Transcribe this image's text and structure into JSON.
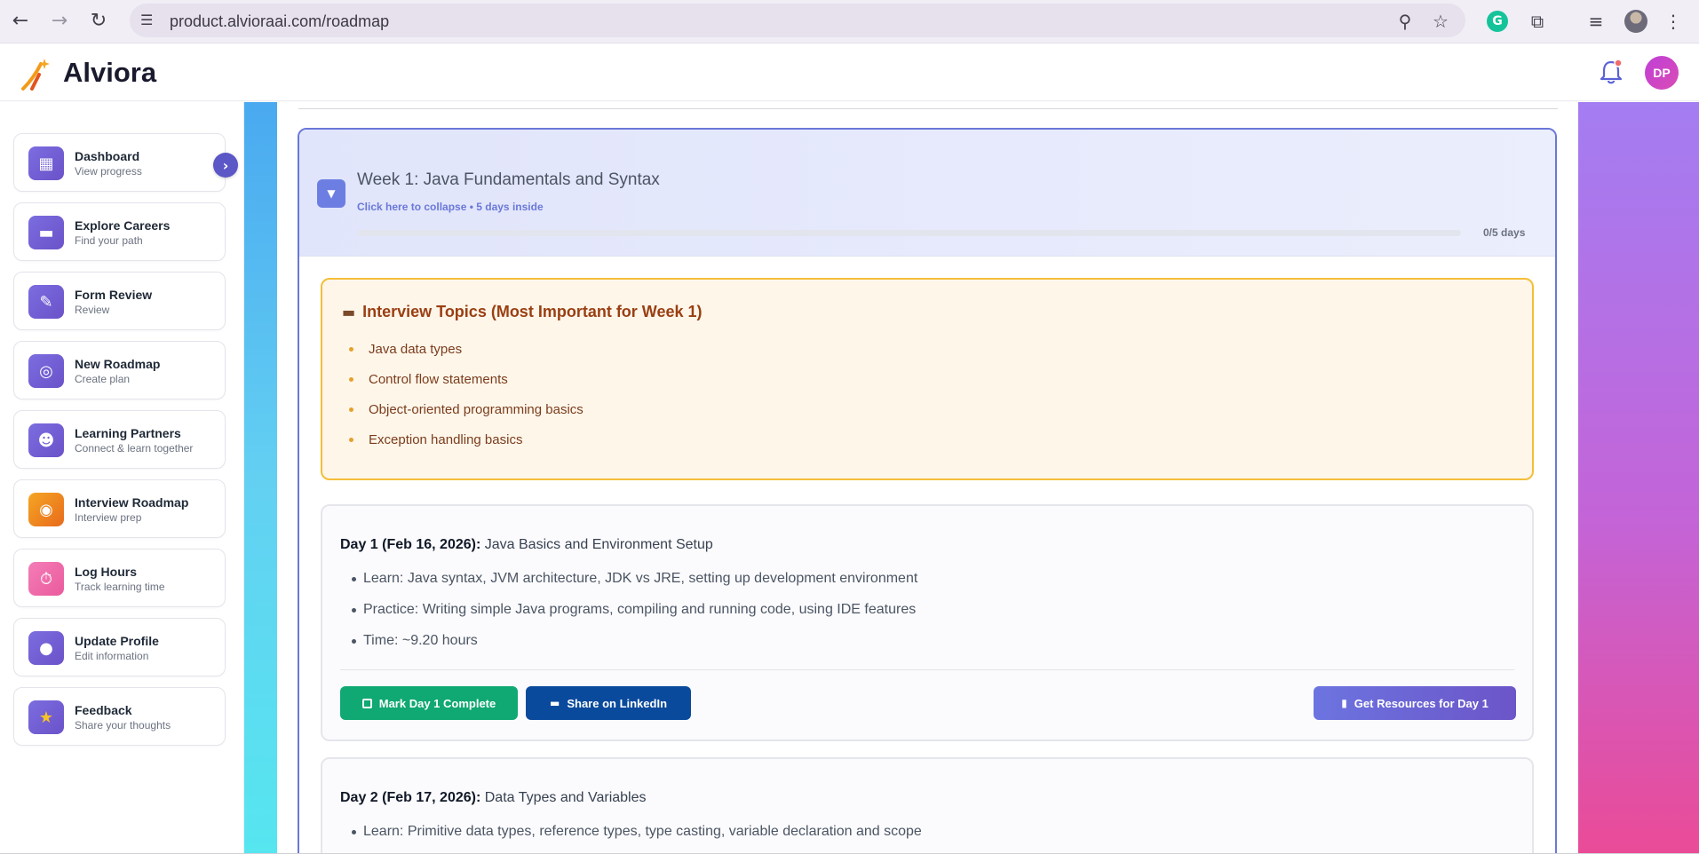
{
  "browser": {
    "url": "product.alvioraai.com/roadmap"
  },
  "app": {
    "name": "Alviora",
    "avatar_initials": "DP",
    "brand_color": "#6a78d8"
  },
  "sidebar": {
    "items": [
      {
        "title": "Dashboard",
        "subtitle": "View progress",
        "icon": "chart-icon"
      },
      {
        "title": "Explore Careers",
        "subtitle": "Find your path",
        "icon": "briefcase-icon"
      },
      {
        "title": "Form Review",
        "subtitle": "Review",
        "icon": "document-icon"
      },
      {
        "title": "New Roadmap",
        "subtitle": "Create plan",
        "icon": "compass-icon"
      },
      {
        "title": "Learning Partners",
        "subtitle": "Connect & learn together",
        "icon": "people-icon"
      },
      {
        "title": "Interview Roadmap",
        "subtitle": "Interview prep",
        "icon": "target-icon"
      },
      {
        "title": "Log Hours",
        "subtitle": "Track learning time",
        "icon": "stopwatch-icon"
      },
      {
        "title": "Update Profile",
        "subtitle": "Edit information",
        "icon": "user-icon"
      },
      {
        "title": "Feedback",
        "subtitle": "Share your thoughts",
        "icon": "star-icon"
      }
    ]
  },
  "week": {
    "title": "Week 1: Java Fundamentals and Syntax",
    "subtitle": "Click here to collapse • 5 days inside",
    "progress_label": "0/5 days",
    "progress_fraction": 0
  },
  "topics": {
    "title": "Interview Topics (Most Important for Week 1)",
    "items": [
      "Java data types",
      "Control flow statements",
      "Object-oriented programming basics",
      "Exception handling basics"
    ]
  },
  "days": [
    {
      "label": "Day 1 (Feb 16, 2026):",
      "topic": "Java Basics and Environment Setup",
      "items": [
        "Learn: Java syntax, JVM architecture, JDK vs JRE, setting up development environment",
        "Practice: Writing simple Java programs, compiling and running code, using IDE features",
        "Time: ~9.20 hours"
      ],
      "complete_label": "Mark Day 1 Complete",
      "linkedin_label": "Share on LinkedIn",
      "resources_label": "Get Resources for Day 1"
    },
    {
      "label": "Day 2 (Feb 17, 2026):",
      "topic": "Data Types and Variables",
      "items": [
        "Learn: Primitive data types, reference types, type casting, variable declaration and scope"
      ]
    }
  ]
}
